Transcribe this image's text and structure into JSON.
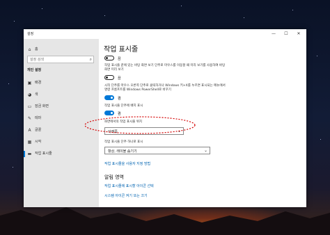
{
  "window": {
    "title": "설정",
    "minimize": "—",
    "maximize": "☐",
    "close": "✕"
  },
  "sidebar": {
    "home_label": "홈",
    "search_placeholder": "설정 검색",
    "group_heading": "개인 설정",
    "items": [
      {
        "label": "배경",
        "icon": "image-icon",
        "glyph": "▣"
      },
      {
        "label": "색",
        "icon": "palette-icon",
        "glyph": "◕"
      },
      {
        "label": "잠금 화면",
        "icon": "lock-screen-icon",
        "glyph": "▭"
      },
      {
        "label": "테마",
        "icon": "theme-icon",
        "glyph": "✎"
      },
      {
        "label": "글꼴",
        "icon": "font-icon",
        "glyph": "A"
      },
      {
        "label": "시작",
        "icon": "start-icon",
        "glyph": "▦"
      },
      {
        "label": "작업 표시줄",
        "icon": "taskbar-icon",
        "glyph": "▬"
      }
    ]
  },
  "main": {
    "title": "작업 표시줄",
    "toggle1_state": "끔",
    "setting2_desc": "작업 표시줄 끝에 있는 바탕 화면 보기 단추로 마우스를 이동할 때 미리 보기를 사용하여 바탕 화면 미리 보기",
    "toggle2_state": "끔",
    "setting3_desc": "시작 단추를 마우스 오른쪽 단추로 클릭하거나 Windows 키+X를 누르면 표시되는 메뉴에서 명령 프롬프트를 Windows PowerShell로 바꾸기",
    "toggle3_state": "켬",
    "setting4_label": "작업 표시줄 단추에 배지 표시",
    "toggle4_state": "켬",
    "position_label": "화면에서의 작업 표시줄 위치",
    "position_value": "아래쪽",
    "combine_label": "작업 표시줄 단추 하나로 표시",
    "combine_value": "항상, 레이블 숨기기",
    "customize_link": "작업 표시줄을 사용자 지정 방법",
    "notify_heading": "알림 영역",
    "notify_link1": "작업 표시줄에 표시할 아이콘 선택",
    "notify_link2": "시스템 아이콘 켜기 또는 끄기"
  },
  "colors": {
    "accent": "#0078d7",
    "link": "#0063b1",
    "annotation": "#d40000"
  }
}
